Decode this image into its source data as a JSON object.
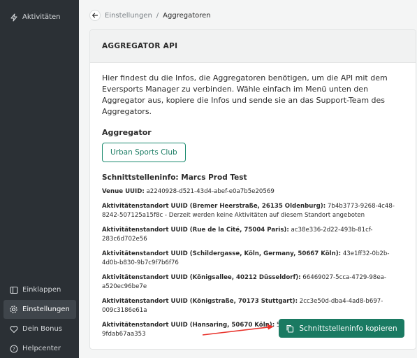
{
  "sidebar": {
    "top_items": [
      {
        "label": "Aktivitäten",
        "icon": "lightning-icon"
      }
    ],
    "bottom_items": [
      {
        "label": "Einklappen",
        "icon": "collapse-icon"
      },
      {
        "label": "Einstellungen",
        "icon": "gear-icon",
        "active": true
      },
      {
        "label": "Dein Bonus",
        "icon": "heart-icon"
      },
      {
        "label": "Helpcenter",
        "icon": "help-icon"
      }
    ]
  },
  "breadcrumb": {
    "parent": "Einstellungen",
    "separator": "/",
    "current": "Aggregatoren"
  },
  "card": {
    "title": "AGGREGATOR API",
    "intro": "Hier findest du die Infos, die Aggregatoren benötigen, um die API mit dem Eversports Manager zu verbinden. Wähle einfach im Menü unten den Aggregator aus, kopiere die Infos und sende sie an das Support-Team des Aggregators.",
    "aggregator_label": "Aggregator",
    "aggregator_selected": "Urban Sports Club",
    "info_title": "Schnittstelleninfo: Marcs Prod Test",
    "info_rows": [
      {
        "label": "Venue UUID:",
        "value": "a2240928-d521-43d4-abef-e0a7b5e20569"
      },
      {
        "label": "Aktivitätenstandort UUID (Bremer Heerstraße, 26135 Oldenburg):",
        "value": "7b4b3773-9268-4c48-8242-507125a15f8c - Derzeit werden keine Aktivitäten auf diesem Standort angeboten"
      },
      {
        "label": "Aktivitätenstandort UUID (Rue de la Cité, 75004 Paris):",
        "value": "ac38e336-2d22-493b-81cf-283c6d702e56"
      },
      {
        "label": "Aktivitätenstandort UUID (Schildergasse, Köln, Germany, 50667 Köln):",
        "value": "43e1ff32-0b2b-4d0b-b830-9b7c9f7b6f76"
      },
      {
        "label": "Aktivitätenstandort UUID (Königsallee, 40212 Düsseldorf):",
        "value": "66469027-5cca-4729-98ea-a520ec96be7e"
      },
      {
        "label": "Aktivitätenstandort UUID (Königstraße, 70173 Stuttgart):",
        "value": "2cc3e50d-dba4-4ad8-b697-009c3186e61a"
      },
      {
        "label": "Aktivitätenstandort UUID (Hansaring, 50670 Köln):",
        "value": "5458a57f-29d5-429a-8d3b-9fdab67aa353"
      }
    ],
    "copy_button": "Schnittstelleninfo kopieren"
  },
  "colors": {
    "sidebar_bg": "#2b3035",
    "accent": "#1a7a62",
    "arrow": "#e8322b"
  }
}
